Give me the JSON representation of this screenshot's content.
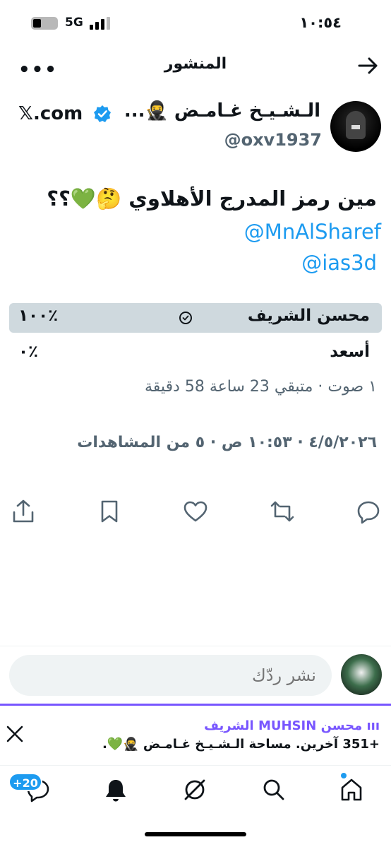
{
  "status": {
    "time": "١٠:٥٤",
    "network": "5G",
    "battery_level": 0.35
  },
  "header": {
    "title": "المنشور"
  },
  "author": {
    "name": "الـشـيـخ غـامـض 🥷...",
    "handle": "@oxv1937",
    "source": "𝕏.com"
  },
  "post": {
    "text": "مين رمز المدرج الأهلاوي 🤔💚؟؟",
    "mentions": [
      "@MnAlSharef",
      "@ias3d"
    ],
    "meta": "٤/٥/٢٠٢٦ · ١٠:٥٣ ص · ٥ من المشاهدات"
  },
  "poll": {
    "options": [
      {
        "label": "محسن الشريف",
        "percent_text": "١٠٠٪",
        "fraction": 1.0,
        "selected": true
      },
      {
        "label": "أسعد",
        "percent_text": "٠٪",
        "fraction": 0.0,
        "selected": false
      }
    ],
    "meta": "١ صوت · متبقي 23 ساعة 58 دقيقة"
  },
  "reply": {
    "placeholder": "نشر ردّك"
  },
  "spaces": {
    "host": "ııı محسن MUHSIN الشريف",
    "subtitle": "+351 آخرين.  مساحة الـشـيـخ غـامـض 🥷💚."
  },
  "nav": {
    "badge": "+20"
  },
  "colors": {
    "accent": "#1d9bf0",
    "spaces": "#7856ff",
    "poll_fill": "#cfd9de"
  }
}
